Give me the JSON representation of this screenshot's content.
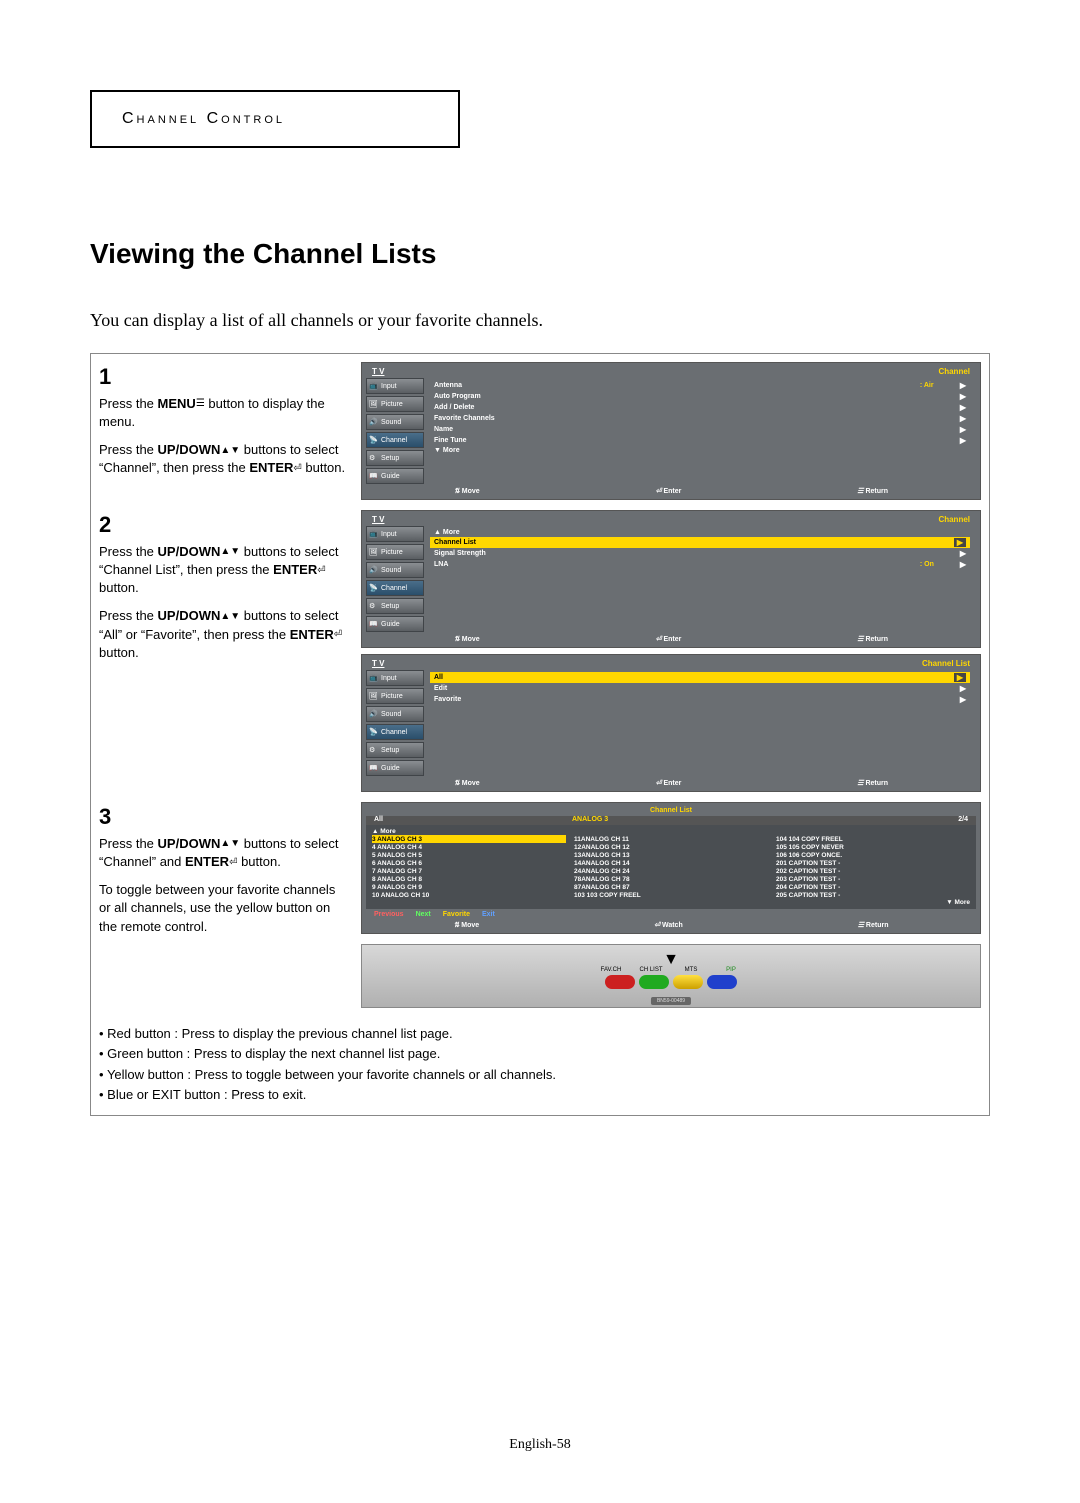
{
  "chapter": "Channel Control",
  "title": "Viewing the Channel Lists",
  "intro": "You can display a list of all channels or your favorite channels.",
  "steps": {
    "s1": {
      "num": "1",
      "p1a": "Press the ",
      "p1b": "MENU",
      "p1c": " button to display the menu.",
      "p2a": "Press the ",
      "p2b": "UP/DOWN",
      "p2c": " buttons to select “Channel”, then press the ",
      "p2d": "ENTER",
      "p2e": " button."
    },
    "s2": {
      "num": "2",
      "p1a": "Press the ",
      "p1b": "UP/DOWN",
      "p1c": " buttons to select “Channel List”, then press the ",
      "p1d": "ENTER",
      "p1e": " button.",
      "p2a": "Press the ",
      "p2b": "UP/DOWN",
      "p2c": " buttons to select “All” or “Favorite”, then press the ",
      "p2d": "ENTER",
      "p2e": " button."
    },
    "s3": {
      "num": "3",
      "p1a": "Press the ",
      "p1b": "UP/DOWN",
      "p1c": " buttons to select “Channel” and ",
      "p1d": "ENTER",
      "p1e": " button.",
      "p2": "To toggle between your favorite channels or all channels, use the yellow button on the remote control."
    }
  },
  "sidebar": {
    "items": [
      "Input",
      "Picture",
      "Sound",
      "Channel",
      "Setup",
      "Guide"
    ]
  },
  "menu1": {
    "tv": "T V",
    "section": "Channel",
    "rows": [
      {
        "label": "Antenna",
        "val": ": Air"
      },
      {
        "label": "Auto Program"
      },
      {
        "label": "Add / Delete"
      },
      {
        "label": "Favorite Channels"
      },
      {
        "label": "Name"
      },
      {
        "label": "Fine Tune"
      },
      {
        "label": "▼ More",
        "more": true
      }
    ]
  },
  "menu2": {
    "tv": "T V",
    "section": "Channel",
    "rows": [
      {
        "label": "▲ More",
        "more": true
      },
      {
        "label": "Channel List",
        "hl": true
      },
      {
        "label": "Signal Strength"
      },
      {
        "label": "LNA",
        "val": ": On"
      }
    ]
  },
  "menu3": {
    "tv": "T V",
    "section": "Channel List",
    "rows": [
      {
        "label": "All",
        "hl": true
      },
      {
        "label": "Edit"
      },
      {
        "label": "Favorite"
      }
    ]
  },
  "footer": {
    "move": "Move",
    "enter": "Enter",
    "return": "Return",
    "watch": "Watch"
  },
  "chlist": {
    "title": "Channel List",
    "sub": {
      "c1": "All",
      "c2": "ANALOG 3",
      "c3": "2/4"
    },
    "more_up": "▲ More",
    "more_dn": "▼ More",
    "grid": [
      "3 ANALOG CH 3",
      "11ANALOG CH 11",
      "104 104 COPY FREEL",
      "4 ANALOG CH 4",
      "12ANALOG CH 12",
      "105 105 COPY NEVER",
      "5 ANALOG CH 5",
      "13ANALOG CH 13",
      "106 106 COPY ONCE.",
      "6 ANALOG CH 6",
      "14ANALOG CH 14",
      "201 CAPTION TEST -",
      "7 ANALOG CH 7",
      "24ANALOG CH 24",
      "202 CAPTION TEST -",
      "8 ANALOG CH 8",
      "78ANALOG CH 78",
      "203 CAPTION TEST -",
      "9 ANALOG CH 9",
      "87ANALOG CH 87",
      "204 CAPTION TEST -",
      "10 ANALOG CH 10",
      "103 103 COPY FREEL",
      "205 CAPTION TEST -"
    ],
    "foot": {
      "prev": "Previous",
      "next": "Next",
      "fav": "Favorite",
      "exit": "Exit"
    }
  },
  "remote": {
    "labels": [
      "FAV.CH",
      "CH LIST",
      "MTS",
      "PIP"
    ],
    "model": "BN59-00489"
  },
  "bullets": [
    "Red button : Press to display the previous channel list page.",
    "Green button : Press to display the next  channel list page.",
    "Yellow button : Press to toggle between your favorite channels or all channels.",
    "Blue or EXIT button : Press to exit."
  ],
  "page_num": "English-58"
}
